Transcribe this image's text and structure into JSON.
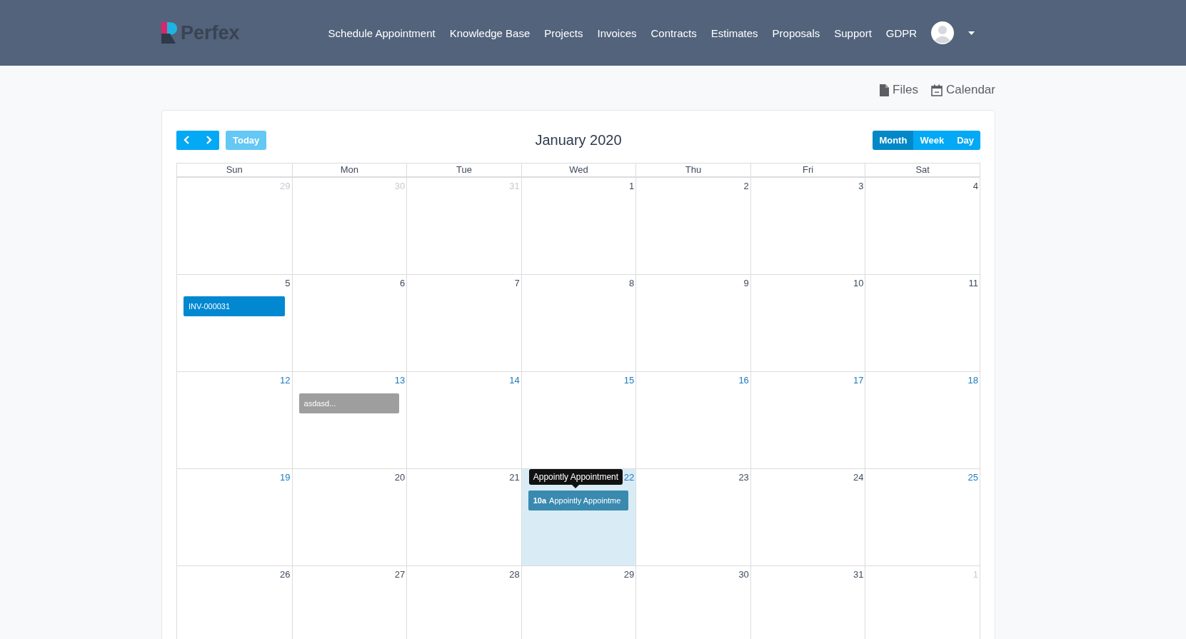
{
  "header": {
    "logo": "Perfex",
    "nav": [
      "Schedule Appointment",
      "Knowledge Base",
      "Projects",
      "Invoices",
      "Contracts",
      "Estimates",
      "Proposals",
      "Support",
      "GDPR"
    ]
  },
  "toolbar_links": [
    {
      "label": "Files",
      "kind": "file"
    },
    {
      "label": "Calendar",
      "kind": "calendar"
    }
  ],
  "calendar": {
    "title": "January 2020",
    "today_label": "Today",
    "views": [
      {
        "label": "Month",
        "selected": true
      },
      {
        "label": "Week",
        "selected": false
      },
      {
        "label": "Day",
        "selected": false
      }
    ],
    "weekdays": [
      "Sun",
      "Mon",
      "Tue",
      "Wed",
      "Thu",
      "Fri",
      "Sat"
    ],
    "weeks": [
      [
        {
          "day": "29",
          "kind": "other"
        },
        {
          "day": "30",
          "kind": "other"
        },
        {
          "day": "31",
          "kind": "other"
        },
        {
          "day": "1",
          "kind": "normal"
        },
        {
          "day": "2",
          "kind": "normal"
        },
        {
          "day": "3",
          "kind": "normal"
        },
        {
          "day": "4",
          "kind": "normal"
        }
      ],
      [
        {
          "day": "5",
          "kind": "normal",
          "events": [
            {
              "text": "INV-000031",
              "color": "#0288d1"
            }
          ]
        },
        {
          "day": "6",
          "kind": "normal"
        },
        {
          "day": "7",
          "kind": "normal"
        },
        {
          "day": "8",
          "kind": "normal"
        },
        {
          "day": "9",
          "kind": "normal"
        },
        {
          "day": "10",
          "kind": "normal"
        },
        {
          "day": "11",
          "kind": "normal"
        }
      ],
      [
        {
          "day": "12",
          "kind": "link"
        },
        {
          "day": "13",
          "kind": "link",
          "events": [
            {
              "text": "asdasd...",
              "color": "#9e9e9e"
            }
          ]
        },
        {
          "day": "14",
          "kind": "link"
        },
        {
          "day": "15",
          "kind": "link"
        },
        {
          "day": "16",
          "kind": "link"
        },
        {
          "day": "17",
          "kind": "link"
        },
        {
          "day": "18",
          "kind": "link"
        }
      ],
      [
        {
          "day": "19",
          "kind": "link"
        },
        {
          "day": "20",
          "kind": "normal"
        },
        {
          "day": "21",
          "kind": "normal"
        },
        {
          "day": "22",
          "kind": "link",
          "today": true,
          "events": [
            {
              "time": "10a",
              "text": "Appointly Appointme",
              "color": "#3a8ab0",
              "tooltip": "Appointly Appointment"
            }
          ]
        },
        {
          "day": "23",
          "kind": "normal"
        },
        {
          "day": "24",
          "kind": "normal"
        },
        {
          "day": "25",
          "kind": "link"
        }
      ],
      [
        {
          "day": "26",
          "kind": "normal"
        },
        {
          "day": "27",
          "kind": "normal"
        },
        {
          "day": "28",
          "kind": "normal"
        },
        {
          "day": "29",
          "kind": "normal"
        },
        {
          "day": "30",
          "kind": "normal"
        },
        {
          "day": "31",
          "kind": "normal"
        },
        {
          "day": "1",
          "kind": "other"
        }
      ]
    ]
  }
}
